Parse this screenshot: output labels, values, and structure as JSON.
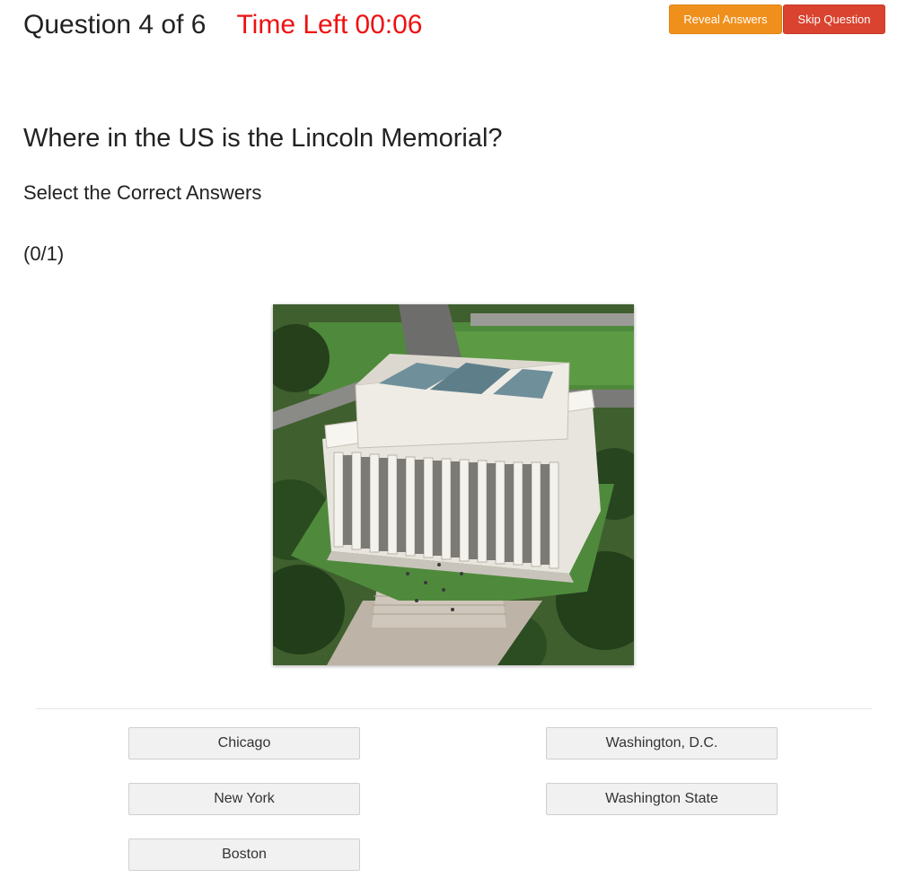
{
  "header": {
    "question_counter": "Question 4 of 6",
    "timer_label": "Time Left",
    "timer_value": "00:06",
    "timer_color": "#ee1111"
  },
  "buttons": {
    "reveal_label": "Reveal Answers",
    "reveal_color": "#f0901c",
    "skip_label": "Skip Question",
    "skip_color": "#d9432f"
  },
  "question": {
    "text": "Where in the US is the Lincoln Memorial?",
    "instruction": "Select the Correct Answers",
    "progress": "(0/1)"
  },
  "image": {
    "subject": "aerial photo of a white columned marble memorial building"
  },
  "answers": [
    {
      "label": "Chicago"
    },
    {
      "label": "Washington, D.C."
    },
    {
      "label": "New York"
    },
    {
      "label": "Washington State"
    },
    {
      "label": "Boston"
    }
  ]
}
